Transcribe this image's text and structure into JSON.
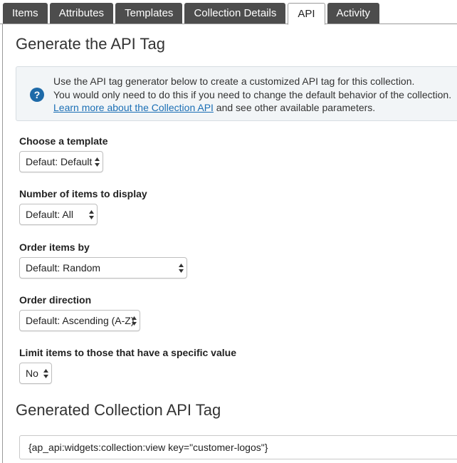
{
  "tabs": [
    {
      "label": "Items"
    },
    {
      "label": "Attributes"
    },
    {
      "label": "Templates"
    },
    {
      "label": "Collection Details"
    },
    {
      "label": "API"
    },
    {
      "label": "Activity"
    }
  ],
  "main": {
    "title": "Generate the API Tag",
    "info": {
      "line1": "Use the API tag generator below to create a customized API tag for this collection.",
      "line2": "You would only need to do this if you need to change the default behavior of the collection.",
      "link": "Learn more about the Collection API",
      "line3_rest": " and see other available parameters."
    },
    "fields": {
      "template": {
        "label": "Choose a template",
        "value": "Defaut: Default"
      },
      "count": {
        "label": "Number of items to display",
        "value": "Default: All"
      },
      "order_by": {
        "label": "Order items by",
        "value": "Default: Random"
      },
      "direction": {
        "label": "Order direction",
        "value": "Default: Ascending (A-Z)"
      },
      "limit": {
        "label": "Limit items to those that have a specific value",
        "value": "No"
      }
    },
    "generated_title": "Generated Collection API Tag",
    "generated_tag": "{ap_api:widgets:collection:view key=\"customer-logos\"}"
  },
  "colors": {
    "tab_bg": "#4d4d4d",
    "accent": "#1e6aa8",
    "link": "#1b6fb5"
  },
  "icons": {
    "info": "question-circle-icon",
    "select_arrows": "select-arrows-icon"
  }
}
